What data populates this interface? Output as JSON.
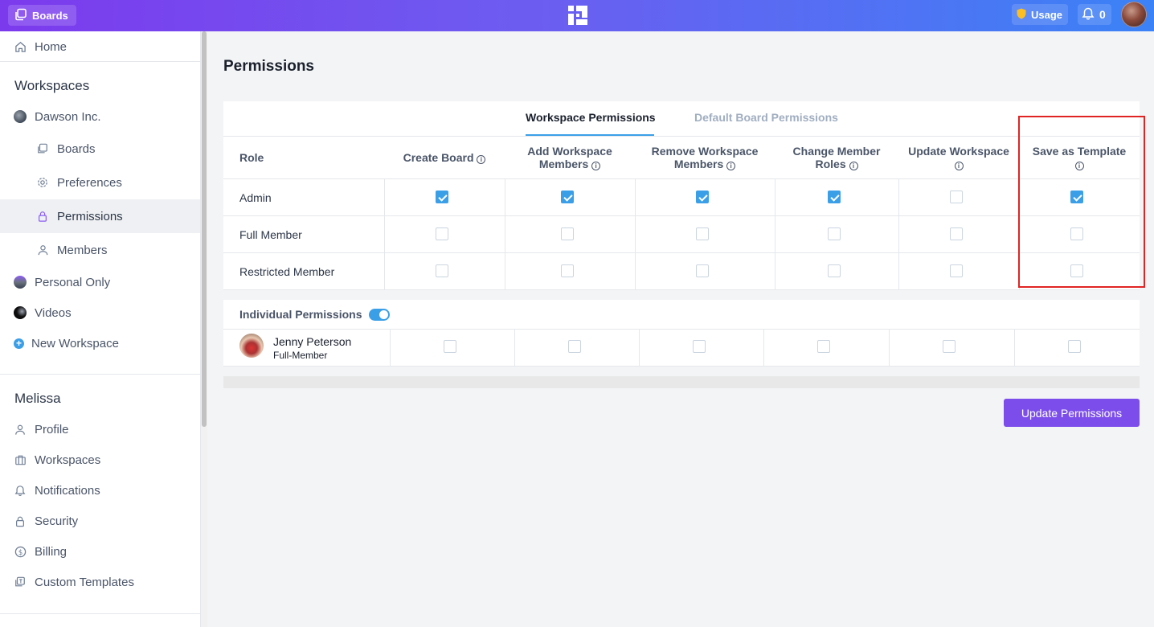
{
  "topbar": {
    "boards_label": "Boards",
    "usage_label": "Usage",
    "notifications_count": "0"
  },
  "sidebar": {
    "home": "Home",
    "workspaces_heading": "Workspaces",
    "workspace_name": "Dawson Inc.",
    "sub_items": [
      "Boards",
      "Preferences",
      "Permissions",
      "Members"
    ],
    "other_workspaces": [
      "Personal Only",
      "Videos"
    ],
    "new_workspace": "New Workspace",
    "user_heading": "Melissa",
    "user_items": [
      "Profile",
      "Workspaces",
      "Notifications",
      "Security",
      "Billing",
      "Custom Templates"
    ]
  },
  "page": {
    "title": "Permissions",
    "tabs": [
      "Workspace Permissions",
      "Default Board Permissions"
    ],
    "active_tab": "Workspace Permissions"
  },
  "table": {
    "role_header": "Role",
    "columns": [
      {
        "line1": "Create Board",
        "line2": ""
      },
      {
        "line1": "Add Workspace",
        "line2": "Members"
      },
      {
        "line1": "Remove Workspace",
        "line2": "Members"
      },
      {
        "line1": "Change Member",
        "line2": "Roles"
      },
      {
        "line1": "Update Workspace",
        "line2": ""
      },
      {
        "line1": "Save as Template",
        "line2": ""
      }
    ],
    "rows": [
      {
        "role": "Admin",
        "checks": [
          true,
          true,
          true,
          true,
          false,
          true
        ]
      },
      {
        "role": "Full Member",
        "checks": [
          false,
          false,
          false,
          false,
          false,
          false
        ]
      },
      {
        "role": "Restricted Member",
        "checks": [
          false,
          false,
          false,
          false,
          false,
          false
        ]
      }
    ]
  },
  "individual": {
    "title": "Individual Permissions",
    "toggle_on": true,
    "users": [
      {
        "name": "Jenny Peterson",
        "role": "Full-Member",
        "checks": [
          false,
          false,
          false,
          false,
          false,
          false
        ]
      }
    ]
  },
  "update_button": "Update Permissions",
  "colors": {
    "accent": "#3b9fe8",
    "button": "#7c4dea",
    "highlight": "#e02424"
  }
}
